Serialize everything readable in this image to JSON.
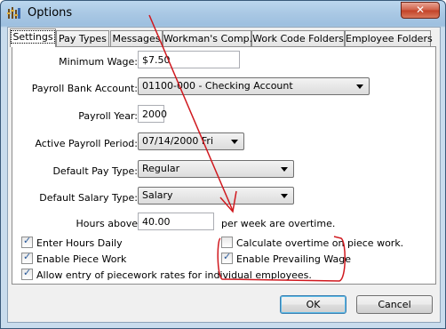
{
  "window": {
    "title": "Options",
    "close_glyph": "✕",
    "icon": "options-app-icon"
  },
  "tabs": [
    {
      "label": "Settings",
      "active": true
    },
    {
      "label": "Pay Types",
      "active": false
    },
    {
      "label": "Messages",
      "active": false
    },
    {
      "label": "Workman's Comp.",
      "active": false
    },
    {
      "label": "Work Code Folders",
      "active": false
    },
    {
      "label": "Employee Folders",
      "active": false
    }
  ],
  "settings": {
    "minimum_wage": {
      "label": "Minimum Wage:",
      "value": "$7.50"
    },
    "payroll_bank_account": {
      "label": "Payroll Bank Account:",
      "value": "01100-000 - Checking Account"
    },
    "payroll_year": {
      "label": "Payroll Year:",
      "value": "2000"
    },
    "active_payroll_period": {
      "label": "Active Payroll Period:",
      "value": "07/14/2000 Fri"
    },
    "default_pay_type": {
      "label": "Default Pay Type:",
      "value": "Regular"
    },
    "default_salary_type": {
      "label": "Default Salary Type:",
      "value": "Salary"
    },
    "hours_above": {
      "label": "Hours above",
      "value": "40.00",
      "suffix": "per week are overtime."
    },
    "checkboxes": [
      {
        "label": "Enter Hours Daily",
        "checked": true
      },
      {
        "label": "Calculate overtime on piece work.",
        "checked": false
      },
      {
        "label": "Enable Piece Work",
        "checked": true
      },
      {
        "label": "Enable Prevailing Wage",
        "checked": true
      },
      {
        "label": "Allow entry of piecework rates for individual employees.",
        "checked": true
      }
    ]
  },
  "buttons": {
    "ok": "OK",
    "cancel": "Cancel"
  },
  "annotation": {
    "color": "#d0181e"
  }
}
